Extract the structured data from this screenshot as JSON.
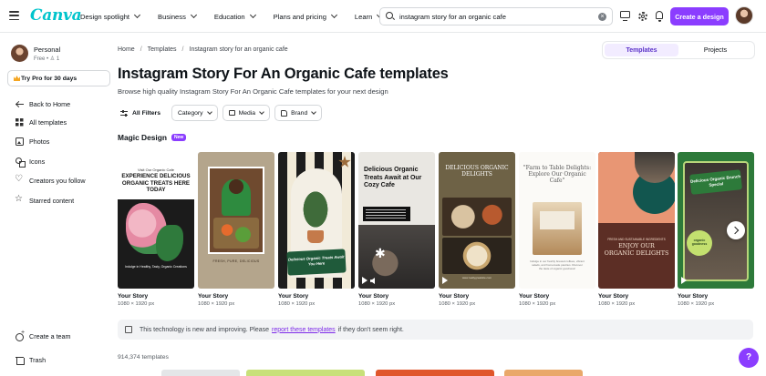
{
  "app": {
    "logo": "Canva"
  },
  "nav": [
    {
      "label": "Design spotlight"
    },
    {
      "label": "Business"
    },
    {
      "label": "Education"
    },
    {
      "label": "Plans and pricing"
    },
    {
      "label": "Learn"
    }
  ],
  "search": {
    "value": "instagram story for an organic cafe",
    "clear": "×"
  },
  "topbar": {
    "create_label": "Create a design"
  },
  "account": {
    "name": "Personal",
    "plan": "Free • ♙ 1"
  },
  "sidebar": {
    "try_pro": "Try Pro for 30 days",
    "items": [
      {
        "label": "Back to Home",
        "icon": "arrow-left-icon"
      },
      {
        "label": "All templates",
        "icon": "grid-icon"
      },
      {
        "label": "Photos",
        "icon": "photo-icon"
      },
      {
        "label": "Icons",
        "icon": "shapes-icon"
      },
      {
        "label": "Creators you follow",
        "icon": "heart-icon"
      },
      {
        "label": "Starred content",
        "icon": "star-icon"
      }
    ],
    "bottom_items": [
      {
        "label": "Create a team",
        "icon": "add-team-icon"
      },
      {
        "label": "Trash",
        "icon": "trash-icon"
      }
    ]
  },
  "breadcrumb": [
    "Home",
    "Templates",
    "Instagram story for an organic cafe"
  ],
  "breadcrumb_sep": "/",
  "toggle": {
    "templates": "Templates",
    "projects": "Projects",
    "active": "Templates"
  },
  "page": {
    "title": "Instagram Story For An Organic Cafe templates",
    "subtitle": "Browse high quality Instagram Story For An Organic Cafe templates for your next design"
  },
  "filters": {
    "all": "All Filters",
    "category": "Category",
    "media": "Media",
    "brand": "Brand"
  },
  "magic": {
    "label": "Magic Design",
    "badge": "New"
  },
  "cards": [
    {
      "title": "Your Story",
      "size": "1080 × 1920 px",
      "preview_small": "Visit Our Organic Cafe",
      "preview_title": "EXPERIENCE DELICIOUS ORGANIC TREATS HERE TODAY",
      "preview_foot": "Indulge in Healthy, Tasty, Organic Creations"
    },
    {
      "title": "Your Story",
      "size": "1080 × 1920 px",
      "preview_foot": "FRESH, PURE, DELICIOUS"
    },
    {
      "title": "Your Story",
      "size": "1080 × 1920 px",
      "preview_label": "Delicious Organic Treats Await You Here"
    },
    {
      "title": "Your Story",
      "size": "1080 × 1920 px",
      "preview_title": "Delicious Organic Treats Await at Our Cozy Cafe"
    },
    {
      "title": "Your Story",
      "size": "1080 × 1920 px",
      "preview_title": "DELICIOUS ORGANIC DELIGHTS",
      "preview_foot": "www.reallygreatsite.com"
    },
    {
      "title": "Your Story",
      "size": "1080 × 1920 px",
      "preview_title": "\"Farm to Table Delights: Explore Our Organic Cafe\"",
      "preview_foot": "Indulge in our freshly brewed coffees, vibrant salads, and homemade pastries. Discover the taste of organic goodness!"
    },
    {
      "title": "Your Story",
      "size": "1080 × 1920 px",
      "preview_small": "FRESH AND SUSTAINABLE INGREDIENTS",
      "preview_title": "ENJOY OUR ORGANIC DELIGHTS"
    },
    {
      "title": "Your Story",
      "size": "1080 × 1920 px",
      "preview_label": "Delicious Organic Brunch Special",
      "preview_stamp": "organic goodness"
    }
  ],
  "notice": {
    "before": "This technology is new and improving. Please",
    "link": "report these templates",
    "after": "if they don't seem right."
  },
  "count": "914,374 templates",
  "help": "?",
  "colors": {
    "brand": "#8b3dff",
    "logo": "#00c4cc"
  }
}
